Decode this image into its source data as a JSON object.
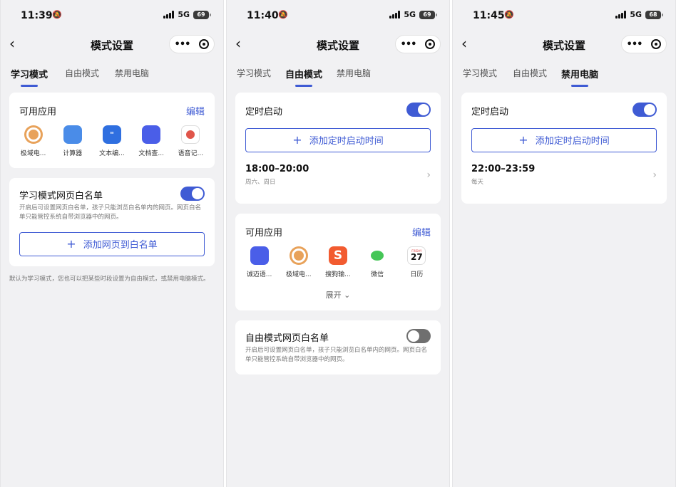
{
  "screens": [
    {
      "status": {
        "time": "11:39",
        "network": "5G",
        "battery": "69"
      },
      "nav": {
        "back": "‹",
        "title": "模式设置"
      },
      "tabs": [
        "学习模式",
        "自由模式",
        "禁用电脑"
      ],
      "active_tab": 0,
      "apps_card": {
        "title": "可用应用",
        "edit": "编辑",
        "apps": [
          {
            "label": "极域电...",
            "icon": "jiyu-icon"
          },
          {
            "label": "计算器",
            "icon": "calculator-icon"
          },
          {
            "label": "文本编...",
            "icon": "text-editor-icon"
          },
          {
            "label": "文档查...",
            "icon": "document-viewer-icon"
          },
          {
            "label": "语音记...",
            "icon": "voice-memo-icon"
          }
        ]
      },
      "whitelist": {
        "title": "学习模式网页白名单",
        "enabled": true,
        "desc": "开启后可设置网页白名单，孩子只能浏览白名单内的网页。网页白名单只能管控系统自带浏览器中的网页。",
        "add_label": "添加网页到白名单"
      },
      "footnote": "默认为学习模式，您也可以把某些时段设置为自由模式，或禁用电脑模式。"
    },
    {
      "status": {
        "time": "11:40",
        "network": "5G",
        "battery": "69"
      },
      "nav": {
        "back": "‹",
        "title": "模式设置"
      },
      "tabs": [
        "学习模式",
        "自由模式",
        "禁用电脑"
      ],
      "active_tab": 1,
      "schedule": {
        "title": "定时启动",
        "enabled": true,
        "add_label": "添加定时启动时间",
        "entry": {
          "range": "18:00–20:00",
          "days": "周六、周日"
        }
      },
      "apps_card": {
        "title": "可用应用",
        "edit": "编辑",
        "apps": [
          {
            "label": "诚迈语...",
            "icon": "chengmai-icon"
          },
          {
            "label": "极域电...",
            "icon": "jiyu-icon"
          },
          {
            "label": "搜狗输...",
            "icon": "sogou-icon"
          },
          {
            "label": "微信",
            "icon": "wechat-icon"
          },
          {
            "label": "日历",
            "icon": "calendar-icon",
            "weekday": "FRIDAY",
            "day": "27"
          }
        ],
        "expand": "展开"
      },
      "whitelist": {
        "title": "自由模式网页白名单",
        "enabled": false,
        "desc": "开启后可设置网页白名单，孩子只能浏览白名单内的网页。网页白名单只能管控系统自带浏览器中的网页。"
      }
    },
    {
      "status": {
        "time": "11:45",
        "network": "5G",
        "battery": "68"
      },
      "nav": {
        "back": "‹",
        "title": "模式设置"
      },
      "tabs": [
        "学习模式",
        "自由模式",
        "禁用电脑"
      ],
      "active_tab": 2,
      "schedule": {
        "title": "定时启动",
        "enabled": true,
        "add_label": "添加定时启动时间",
        "entry": {
          "range": "22:00–23:59",
          "days": "每天"
        }
      }
    }
  ],
  "colors": {
    "accent": "#3f5bd4",
    "background": "#f1f1f3",
    "card": "#ffffff",
    "toggle_off": "#6f6f6f"
  }
}
